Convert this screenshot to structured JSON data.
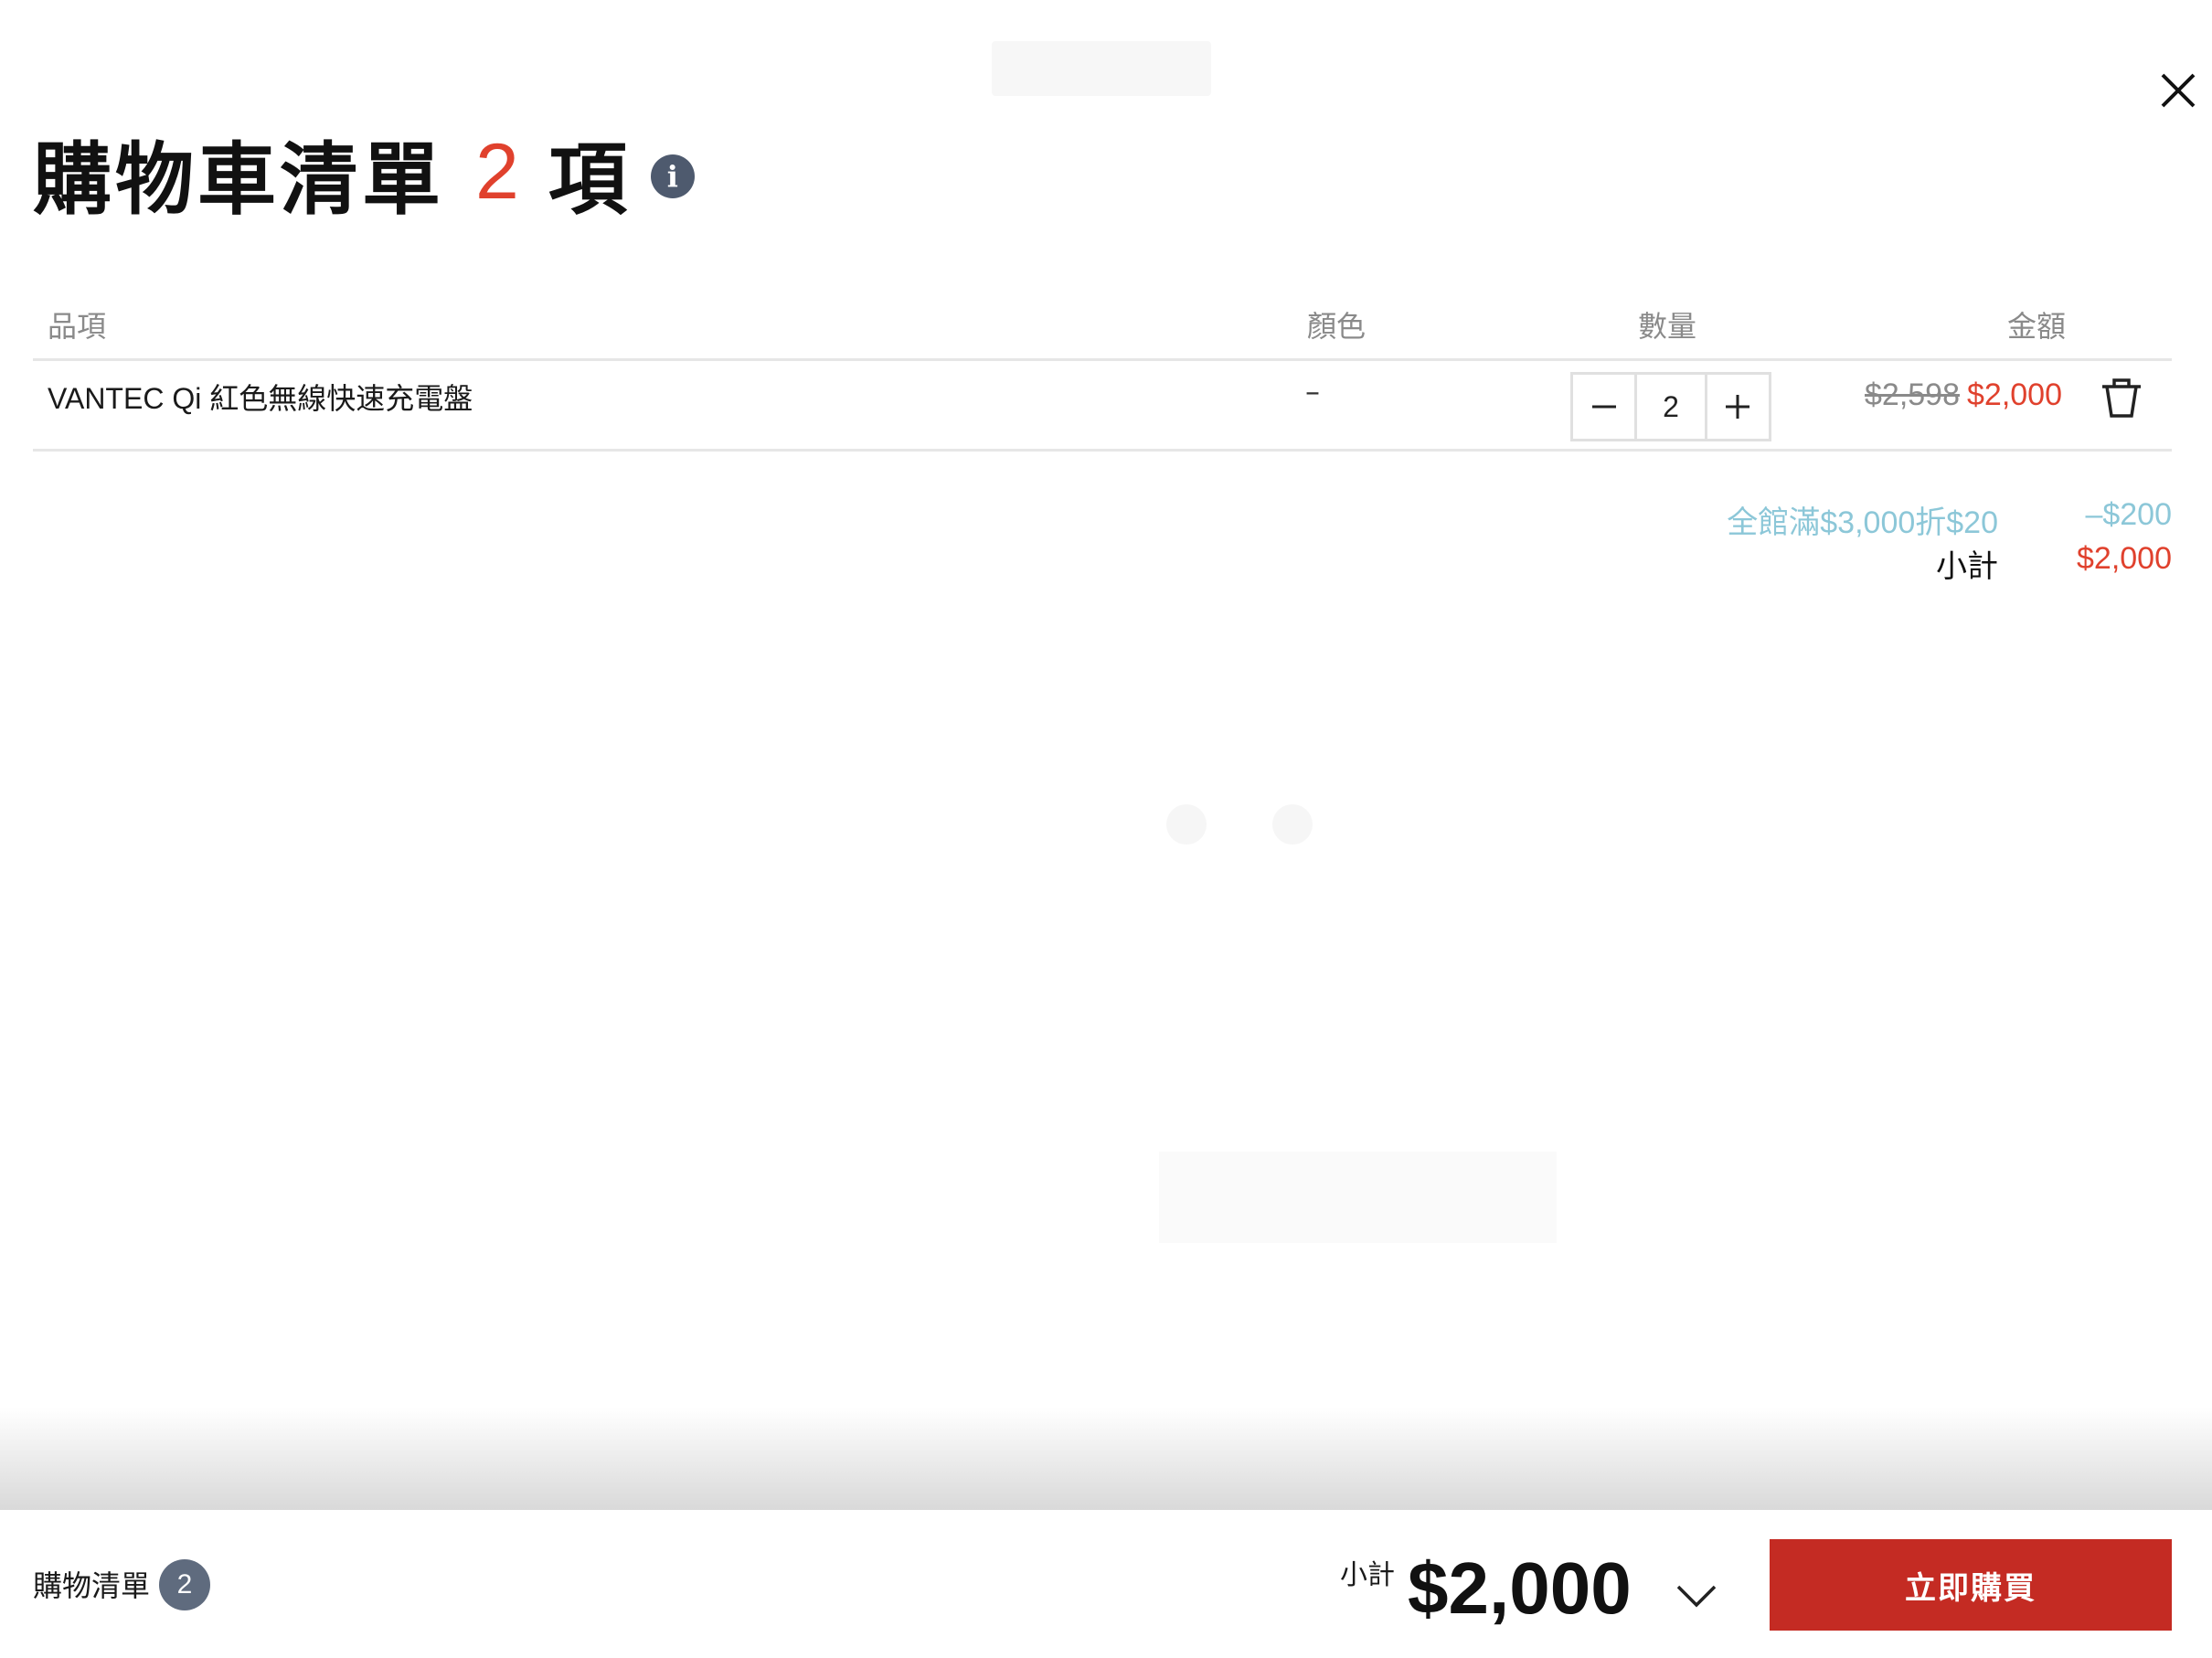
{
  "header": {
    "title": "購物車清單",
    "count": "2",
    "unit": "項"
  },
  "table": {
    "headers": {
      "item": "品項",
      "color": "顏色",
      "qty": "數量",
      "amount": "金額"
    },
    "rows": [
      {
        "name": "VANTEC Qi 紅色無線快速充電盤",
        "color": "–",
        "qty": "2",
        "price_original": "$2,598",
        "price_final": "$2,000"
      }
    ]
  },
  "summary": {
    "discount_label": "全館滿$3,000折$20",
    "discount_value": "–$200",
    "subtotal_label": "小計",
    "subtotal_value": "$2,000"
  },
  "bottom_bar": {
    "cart_label": "購物清單",
    "cart_count": "2",
    "subtotal_label": "小計",
    "subtotal_value": "$2,000",
    "buy_label": "立即購買"
  },
  "colors": {
    "accent_red": "#e0412d",
    "button_red": "#c42b23",
    "discount_blue": "#8cc7d8",
    "badge_slate": "#5f6b7e"
  },
  "icons": {
    "close": "close-icon",
    "info": "info-icon",
    "minus": "minus-icon",
    "plus": "plus-icon",
    "trash": "trash-icon",
    "chevron": "chevron-down-icon"
  }
}
